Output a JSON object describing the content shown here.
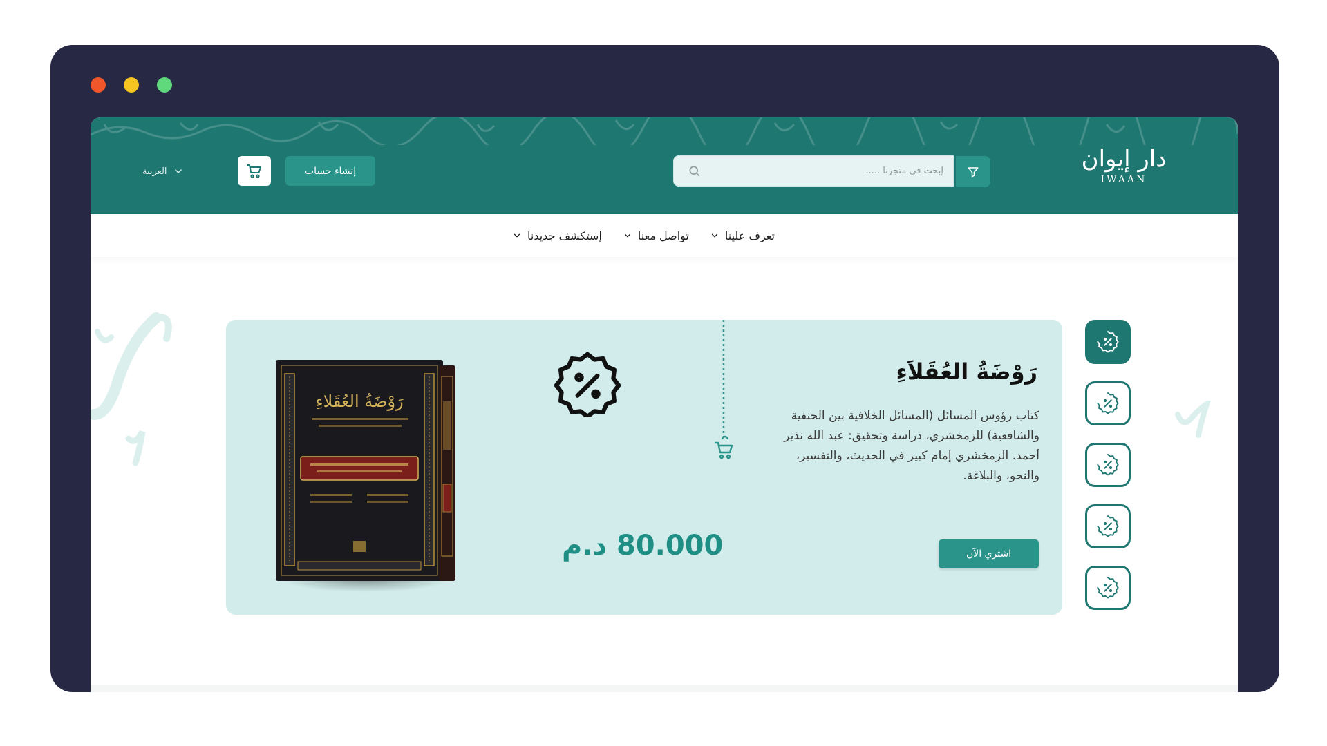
{
  "window": {
    "controls": [
      "close",
      "minimize",
      "maximize"
    ],
    "colors": {
      "close": "#f0562a",
      "minimize": "#f6c521",
      "maximize": "#5fd97c"
    }
  },
  "header": {
    "logo_ar": "دار إيوان",
    "logo_en": "IWAAN",
    "search": {
      "placeholder": "إبحث في متجرنا ....."
    },
    "create_account_label": "إنشاء حساب",
    "language_label": "العربية",
    "icons": {
      "filter": "filter-icon",
      "search": "search-icon",
      "cart": "cart-icon",
      "language_chevron": "chevron-down-icon"
    }
  },
  "nav": {
    "items": [
      {
        "label": "تعرف علينا"
      },
      {
        "label": "تواصل معنا"
      },
      {
        "label": "إستكشف جديدنا"
      }
    ]
  },
  "banner": {
    "title": "رَوْضَةُ العُقَلاَءِ",
    "description": "كتاب رؤوس المسائل (المسائل الخلافية بين الحنفية والشافعية) للزمخشري، دراسة وتحقيق: عبد الله نذير أحمد. الزمخشري إمام كبير في الحديث، والتفسير، والنحو، والبلاغة.",
    "buy_label": "اشتري الآن",
    "price": "80.000 د.م",
    "book_cover_title": "رَوْضَةُ العُقَلاءِ",
    "icons": {
      "discount": "discount-badge-icon",
      "hanging_cart": "cart-icon"
    }
  },
  "side_rail": {
    "count": 5,
    "active_index": 0,
    "icon": "discount-badge-icon"
  },
  "colors": {
    "header_bg": "#1f7771",
    "accent": "#2a948a",
    "banner_bg": "#d1ecea",
    "price": "#1f8f86",
    "frame": "#262844"
  }
}
